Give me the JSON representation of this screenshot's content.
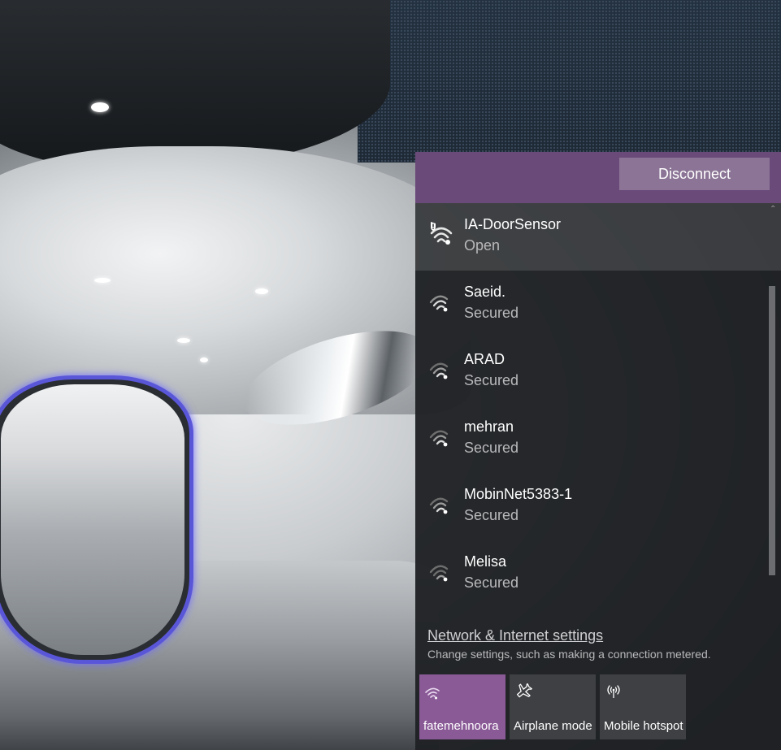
{
  "flyout": {
    "disconnect_label": "Disconnect",
    "networks": [
      {
        "name": "IA-DoorSensor",
        "status": "Open",
        "icon": "wifi-open-shield-icon"
      },
      {
        "name": "Saeid.",
        "status": "Secured",
        "icon": "wifi-secured-icon"
      },
      {
        "name": "ARAD",
        "status": "Secured",
        "icon": "wifi-secured-icon"
      },
      {
        "name": "mehran",
        "status": "Secured",
        "icon": "wifi-secured-icon"
      },
      {
        "name": "MobinNet5383-1",
        "status": "Secured",
        "icon": "wifi-secured-icon"
      },
      {
        "name": "Melisa",
        "status": "Secured",
        "icon": "wifi-secured-icon"
      }
    ],
    "settings_link": "Network & Internet settings",
    "settings_desc": "Change settings, such as making a connection metered.",
    "tiles": [
      {
        "label": "fatemehnoora",
        "icon": "wifi-icon",
        "active": true
      },
      {
        "label": "Airplane mode",
        "icon": "airplane-icon",
        "active": false
      },
      {
        "label": "Mobile hotspot",
        "icon": "hotspot-icon",
        "active": false
      }
    ]
  },
  "colors": {
    "accent": "#6a4a78",
    "accent_tile": "#8a5a97",
    "panel_bg": "#1f2124",
    "tile_bg": "#3e4043"
  }
}
